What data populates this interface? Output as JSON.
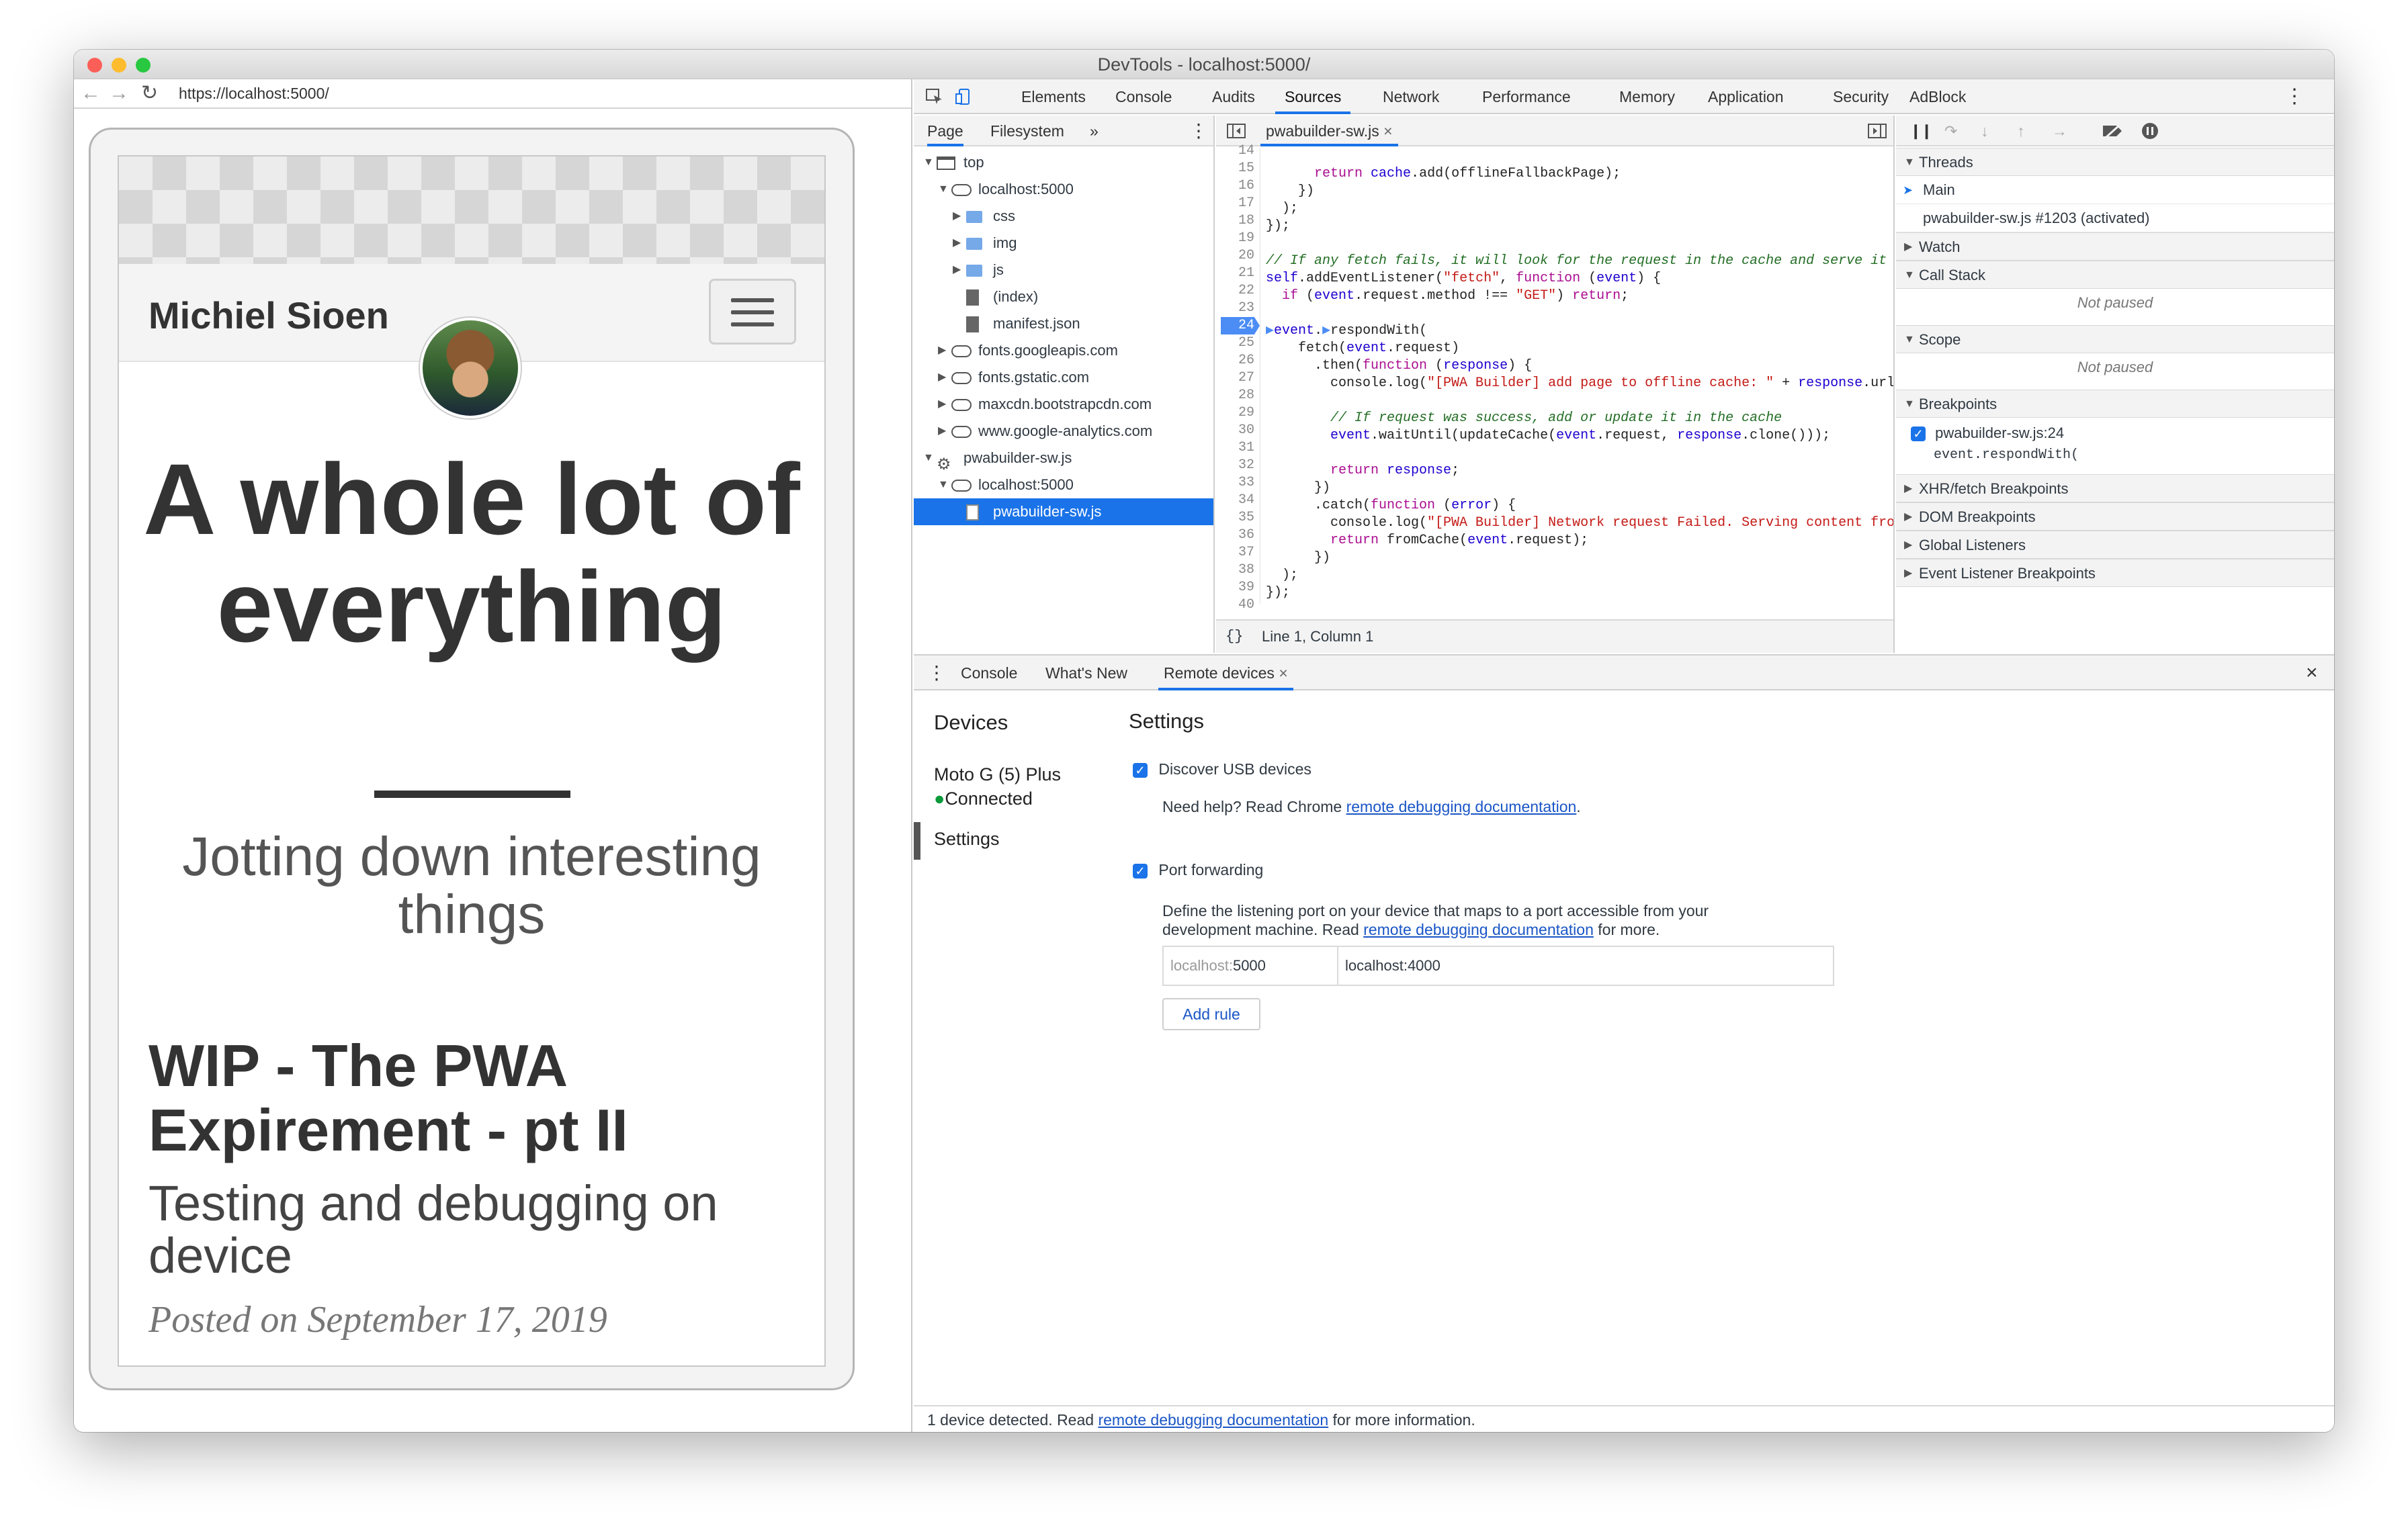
{
  "window": {
    "title": "DevTools - localhost:5000/"
  },
  "preview": {
    "url": "https://localhost:5000/",
    "site_name": "Michiel Sioen",
    "hero_title": "A whole lot of everything",
    "tagline": "Jotting down interesting things",
    "post_title": "WIP - The PWA Expirement - pt II",
    "post_subtitle": "Testing and debugging on device",
    "post_date": "Posted on September 17, 2019"
  },
  "tabs": [
    "Elements",
    "Console",
    "Audits",
    "Sources",
    "Network",
    "Performance",
    "Memory",
    "Application",
    "Security",
    "AdBlock"
  ],
  "active_tab": "Sources",
  "navigator": {
    "subtabs": [
      "Page",
      "Filesystem"
    ],
    "more": "»",
    "tree": [
      "top",
      "localhost:5000",
      "css",
      "img",
      "js",
      "(index)",
      "manifest.json",
      "fonts.googleapis.com",
      "fonts.gstatic.com",
      "maxcdn.bootstrapcdn.com",
      "www.google-analytics.com",
      "pwabuilder-sw.js",
      "localhost:5000",
      "pwabuilder-sw.js"
    ]
  },
  "editor": {
    "file_tab": "pwabuilder-sw.js",
    "line_numbers": [
      "14",
      "15",
      "16",
      "17",
      "18",
      "19",
      "20",
      "21",
      "22",
      "23",
      "24",
      "25",
      "26",
      "27",
      "28",
      "29",
      "30",
      "31",
      "32",
      "33",
      "34",
      "35",
      "36",
      "37",
      "38",
      "39",
      "40"
    ],
    "breakpoint_line": "24",
    "status": "Line 1, Column 1",
    "format_icon": "{}"
  },
  "debugger": {
    "threads_header": "Threads",
    "thread_main": "Main",
    "thread_sw": "pwabuilder-sw.js #1203 (activated)",
    "watch": "Watch",
    "call_stack": "Call Stack",
    "not_paused": "Not paused",
    "scope": "Scope",
    "breakpoints": "Breakpoints",
    "bp_file": "pwabuilder-sw.js:24",
    "bp_code": "event.respondWith(",
    "xhr": "XHR/fetch Breakpoints",
    "dom": "DOM Breakpoints",
    "global": "Global Listeners",
    "event_listener": "Event Listener Breakpoints"
  },
  "drawer": {
    "tabs": [
      "Console",
      "What's New",
      "Remote devices"
    ],
    "devices_header": "Devices",
    "device_name": "Moto G (5) Plus",
    "device_status": "Connected",
    "settings_nav": "Settings",
    "settings_header": "Settings",
    "usb_label": "Discover USB devices",
    "help_prefix": "Need help? Read Chrome ",
    "help_link": "remote debugging documentation",
    "help_suffix": ".",
    "port_forwarding": "Port forwarding",
    "pf_desc_1": "Define the listening port on your device that maps to a port accessible from your",
    "pf_desc_2_prefix": "development machine. Read ",
    "pf_desc_link": "remote debugging documentation",
    "pf_desc_2_suffix": " for more.",
    "port_host": "localhost:",
    "port_num": "5000",
    "port_target": "localhost:4000",
    "add_rule": "Add rule"
  },
  "status": {
    "prefix": "1 device detected. Read ",
    "link": "remote debugging documentation",
    "suffix": " for more information."
  },
  "colors": {
    "accent": "#1a73e8",
    "connected": "#0a9a3a"
  }
}
